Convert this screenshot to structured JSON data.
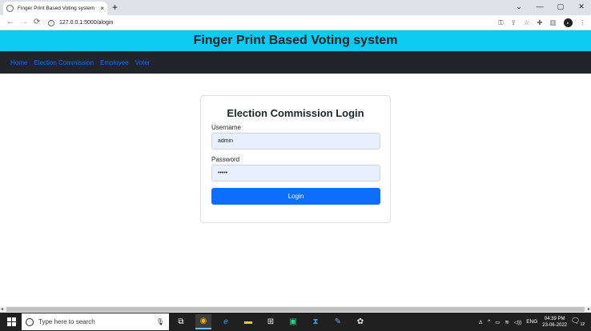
{
  "browser": {
    "tab_title": "Finger Print Based Voting system",
    "tab_close": "×",
    "new_tab": "+",
    "url": "127.0.0.1:5000/alogin",
    "window_controls": [
      "⌄",
      "—",
      "▢",
      "✕"
    ],
    "icons": [
      "back-arrow-icon",
      "forward-arrow-icon",
      "reload-icon",
      "key-icon",
      "share-icon",
      "star-icon",
      "extensions-icon",
      "sidepanel-icon",
      "profile-icon",
      "menu-icon"
    ]
  },
  "site": {
    "title": "Finger Print Based Voting system",
    "nav": [
      "Home",
      "Election Commission",
      "Employee",
      "Voter"
    ],
    "header_color": "#0dcaf0",
    "navbar_color": "#212529",
    "link_color": "#0d6efd"
  },
  "login": {
    "heading": "Election Commission Login",
    "username_label": "Username",
    "username_value": "admin",
    "password_label": "Password",
    "password_value": "•••••",
    "button_label": "Login",
    "button_color": "#0d6efd"
  },
  "taskbar": {
    "search_placeholder": "Type here to search",
    "language": "ENG",
    "time": "04:39 PM",
    "date": "23-06-2022",
    "notification_count": "12"
  }
}
